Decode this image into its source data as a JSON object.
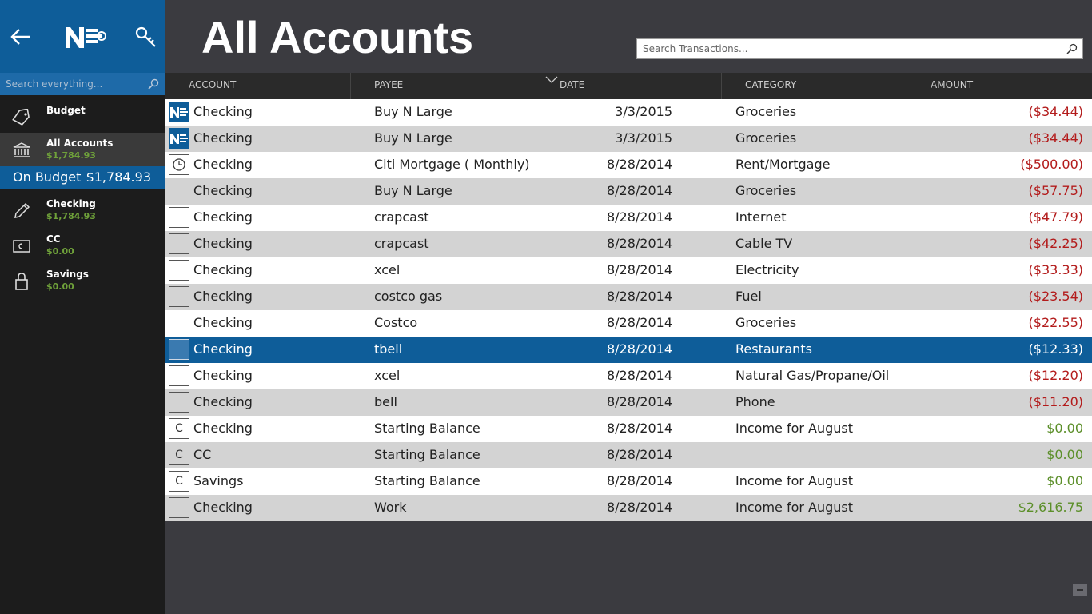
{
  "app": {
    "title": "All Accounts"
  },
  "sidebar": {
    "search_placeholder": "Search everything...",
    "items": [
      {
        "label": "Budget",
        "value": ""
      },
      {
        "label": "All Accounts",
        "value": "$1,784.93"
      },
      {
        "label": "Checking",
        "value": "$1,784.93"
      },
      {
        "label": "CC",
        "value": "$0.00"
      },
      {
        "label": "Savings",
        "value": "$0.00"
      }
    ],
    "on_budget": {
      "label": "On Budget",
      "value": "$1,784.93"
    }
  },
  "search": {
    "placeholder": "Search Transactions..."
  },
  "columns": {
    "account": "ACCOUNT",
    "payee": "PAYEE",
    "date": "DATE",
    "category": "CATEGORY",
    "amount": "AMOUNT"
  },
  "rows": [
    {
      "icon": "ne-logo",
      "account": "Checking",
      "payee": "Buy N Large",
      "date": "3/3/2015",
      "category": "Groceries",
      "amount": "($34.44)",
      "sign": "neg"
    },
    {
      "icon": "ne-logo",
      "account": "Checking",
      "payee": "Buy N Large",
      "date": "3/3/2015",
      "category": "Groceries",
      "amount": "($34.44)",
      "sign": "neg"
    },
    {
      "icon": "clock",
      "account": "Checking",
      "payee": "Citi Mortgage  ( Monthly)",
      "date": "8/28/2014",
      "category": "Rent/Mortgage",
      "amount": "($500.00)",
      "sign": "neg"
    },
    {
      "icon": "",
      "account": "Checking",
      "payee": "Buy N Large",
      "date": "8/28/2014",
      "category": "Groceries",
      "amount": "($57.75)",
      "sign": "neg"
    },
    {
      "icon": "",
      "account": "Checking",
      "payee": "crapcast",
      "date": "8/28/2014",
      "category": "Internet",
      "amount": "($47.79)",
      "sign": "neg"
    },
    {
      "icon": "",
      "account": "Checking",
      "payee": "crapcast",
      "date": "8/28/2014",
      "category": "Cable TV",
      "amount": "($42.25)",
      "sign": "neg"
    },
    {
      "icon": "",
      "account": "Checking",
      "payee": "xcel",
      "date": "8/28/2014",
      "category": "Electricity",
      "amount": "($33.33)",
      "sign": "neg"
    },
    {
      "icon": "",
      "account": "Checking",
      "payee": "costco gas",
      "date": "8/28/2014",
      "category": "Fuel",
      "amount": "($23.54)",
      "sign": "neg"
    },
    {
      "icon": "",
      "account": "Checking",
      "payee": "Costco",
      "date": "8/28/2014",
      "category": "Groceries",
      "amount": "($22.55)",
      "sign": "neg"
    },
    {
      "icon": "",
      "account": "Checking",
      "payee": "tbell",
      "date": "8/28/2014",
      "category": "Restaurants",
      "amount": "($12.33)",
      "sign": "neg",
      "selected": true
    },
    {
      "icon": "",
      "account": "Checking",
      "payee": "xcel",
      "date": "8/28/2014",
      "category": "Natural Gas/Propane/Oil",
      "amount": "($12.20)",
      "sign": "neg"
    },
    {
      "icon": "",
      "account": "Checking",
      "payee": "bell",
      "date": "8/28/2014",
      "category": "Phone",
      "amount": "($11.20)",
      "sign": "neg"
    },
    {
      "icon": "C",
      "account": "Checking",
      "payee": "Starting Balance",
      "date": "8/28/2014",
      "category": "Income for August",
      "amount": "$0.00",
      "sign": "pos"
    },
    {
      "icon": "C",
      "account": "CC",
      "payee": "Starting Balance",
      "date": "8/28/2014",
      "category": "",
      "amount": "$0.00",
      "sign": "pos"
    },
    {
      "icon": "C",
      "account": "Savings",
      "payee": "Starting Balance",
      "date": "8/28/2014",
      "category": "Income for August",
      "amount": "$0.00",
      "sign": "pos"
    },
    {
      "icon": "",
      "account": "Checking",
      "payee": "Work",
      "date": "8/28/2014",
      "category": "Income for August",
      "amount": "$2,616.75",
      "sign": "pos"
    }
  ],
  "colors": {
    "accent": "#0e5d99",
    "negative": "#b31b1b",
    "positive": "#5c8f2a",
    "sidebar_bg": "#1c1c1c",
    "main_bg": "#3b3b40"
  }
}
